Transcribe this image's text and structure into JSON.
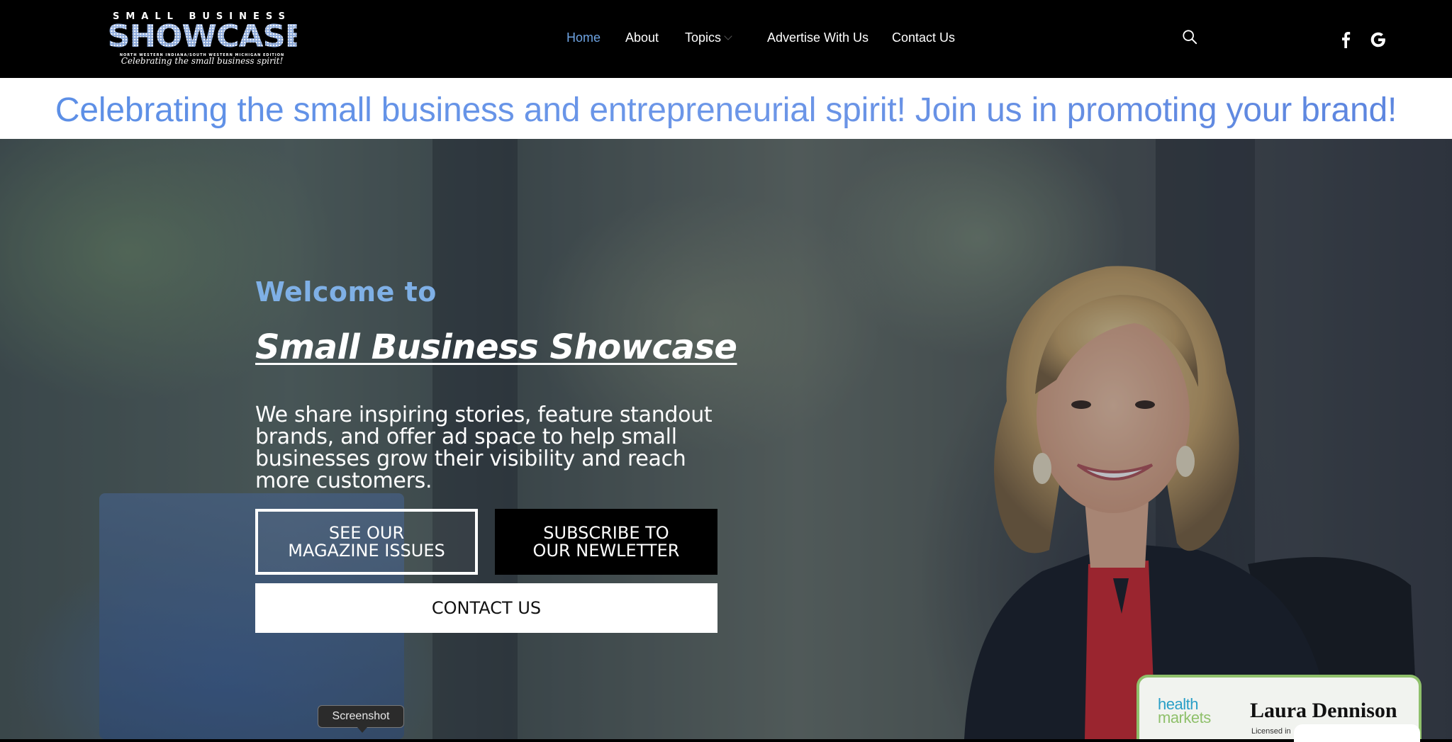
{
  "brand": {
    "logo_top": "SMALL BUSINESS",
    "logo_main": "SHOWCASE",
    "logo_sub": "NORTH WESTERN INDIANA/SOUTH WESTERN MICHIGAN EDITION",
    "logo_tagline": "Celebrating the small business spirit!"
  },
  "nav": {
    "items": [
      {
        "label": "Home",
        "active": true
      },
      {
        "label": "About"
      },
      {
        "label": "Topics",
        "has_dropdown": true
      },
      {
        "label": "Advertise With Us"
      },
      {
        "label": "Contact Us"
      }
    ],
    "icons": [
      "search-icon",
      "facebook-icon",
      "google-icon"
    ]
  },
  "banner": {
    "text": "Celebrating the small business and entrepreneurial spirit! Join us in promoting your brand!"
  },
  "hero": {
    "welcome": "Welcome to",
    "title": "Small Business Showcase",
    "description": "We share inspiring stories, feature standout brands, and offer ad space to help small businesses grow their visibility and reach more customers.",
    "buttons": {
      "magazine": "SEE OUR\nMAGAZINE ISSUES",
      "subscribe": "SUBSCRIBE TO\nOUR NEWLETTER",
      "contact": "CONTACT US"
    }
  },
  "tooltip": {
    "label": "Screenshot"
  },
  "ad_card": {
    "logo_line1": "health",
    "logo_line2": "markets",
    "name": "Laura Dennison",
    "licensed": "Licensed in"
  },
  "colors": {
    "accent": "#6ea3e2",
    "banner_text": "#5b8ee6",
    "header_bg": "#000000",
    "card_border": "#8fc06b"
  }
}
